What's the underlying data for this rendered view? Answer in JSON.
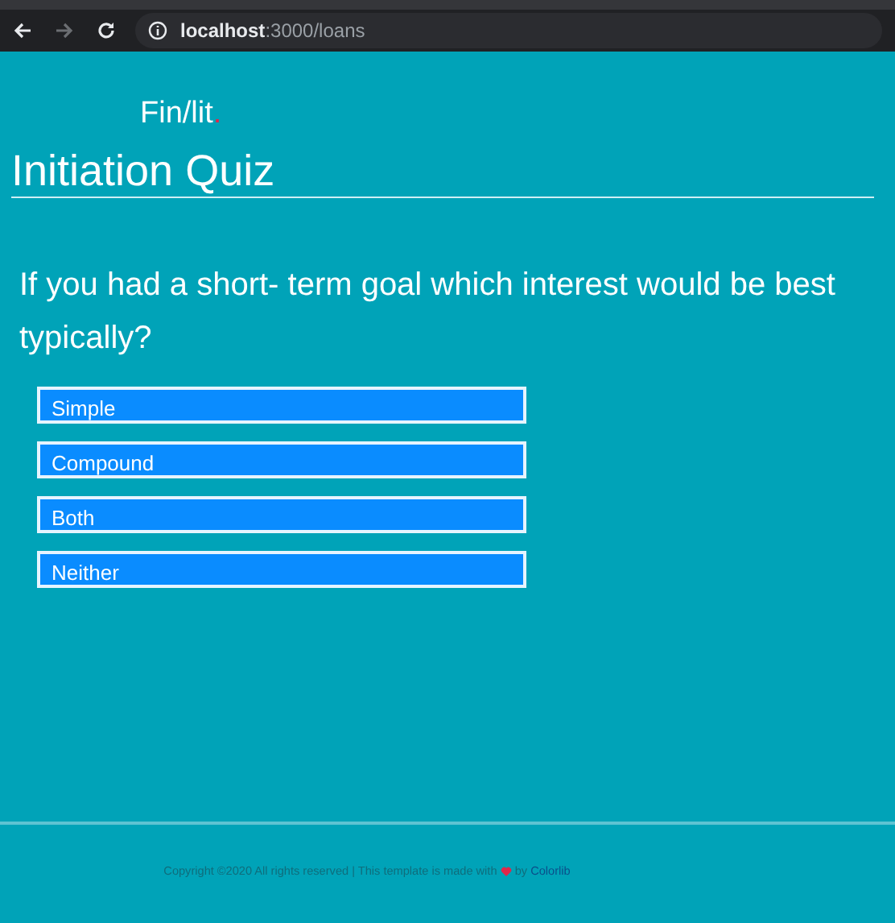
{
  "browser": {
    "url_host": "localhost",
    "url_path": ":3000/loans",
    "forward_disabled": true
  },
  "logo": {
    "text": "Fin/lit",
    "dot": "."
  },
  "title": "Initiation Quiz",
  "question": "If you had a short- term goal which interest would be best typically?",
  "options": [
    {
      "label": "Simple"
    },
    {
      "label": "Compound"
    },
    {
      "label": "Both"
    },
    {
      "label": "Neither"
    }
  ],
  "footer": {
    "text": "Copyright ©2020 All rights reserved | This template is made with",
    "by": "by",
    "link": "Colorlib"
  }
}
